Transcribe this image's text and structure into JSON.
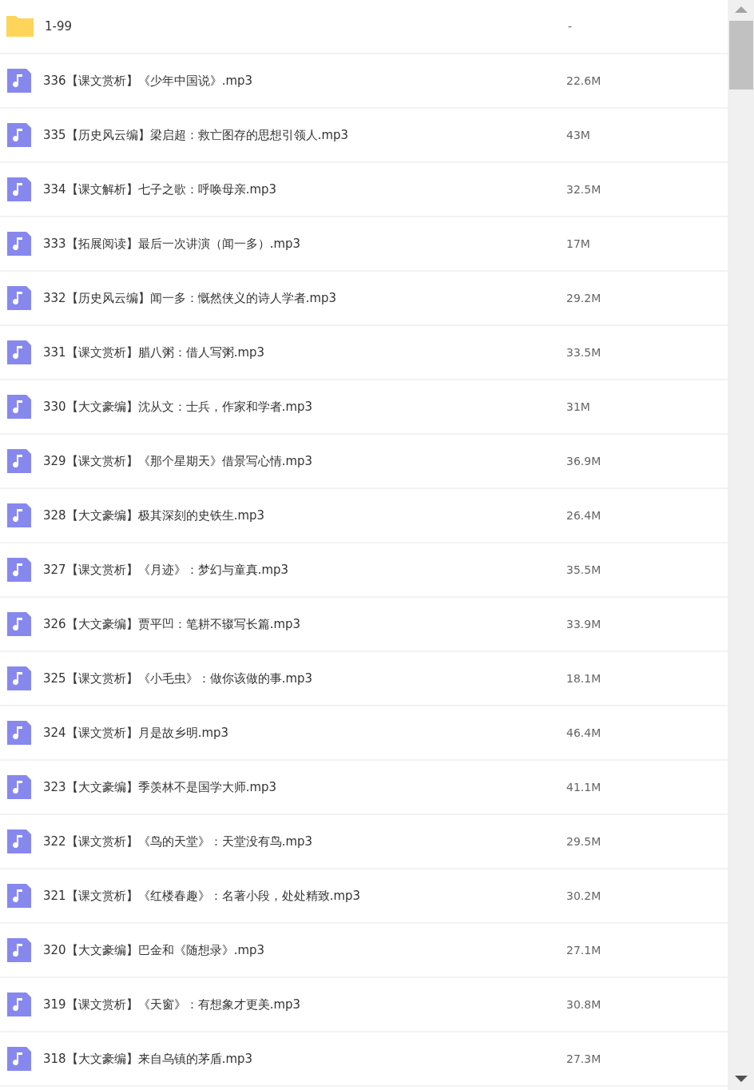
{
  "files": [
    {
      "kind": "folder",
      "name": "1-99",
      "size": "-"
    },
    {
      "kind": "audio",
      "name": "336【课文赏析】《少年中国说》.mp3",
      "size": "22.6M"
    },
    {
      "kind": "audio",
      "name": "335【历史风云编】梁启超：救亡图存的思想引领人.mp3",
      "size": "43M"
    },
    {
      "kind": "audio",
      "name": "334【课文解析】七子之歌：呼唤母亲.mp3",
      "size": "32.5M"
    },
    {
      "kind": "audio",
      "name": "333【拓展阅读】最后一次讲演（闻一多）.mp3",
      "size": "17M"
    },
    {
      "kind": "audio",
      "name": "332【历史风云编】闻一多：慨然侠义的诗人学者.mp3",
      "size": "29.2M"
    },
    {
      "kind": "audio",
      "name": "331【课文赏析】腊八粥：借人写粥.mp3",
      "size": "33.5M"
    },
    {
      "kind": "audio",
      "name": "330【大文豪编】沈从文：士兵，作家和学者.mp3",
      "size": "31M"
    },
    {
      "kind": "audio",
      "name": "329【课文赏析】《那个星期天》借景写心情.mp3",
      "size": "36.9M"
    },
    {
      "kind": "audio",
      "name": "328【大文豪编】极其深刻的史铁生.mp3",
      "size": "26.4M"
    },
    {
      "kind": "audio",
      "name": "327【课文赏析】《月迹》：梦幻与童真.mp3",
      "size": "35.5M"
    },
    {
      "kind": "audio",
      "name": "326【大文豪编】贾平凹：笔耕不辍写长篇.mp3",
      "size": "33.9M"
    },
    {
      "kind": "audio",
      "name": "325【课文赏析】《小毛虫》：做你该做的事.mp3",
      "size": "18.1M"
    },
    {
      "kind": "audio",
      "name": "324【课文赏析】月是故乡明.mp3",
      "size": "46.4M"
    },
    {
      "kind": "audio",
      "name": "323【大文豪编】季羡林不是国学大师.mp3",
      "size": "41.1M"
    },
    {
      "kind": "audio",
      "name": "322【课文赏析】《鸟的天堂》：天堂没有鸟.mp3",
      "size": "29.5M"
    },
    {
      "kind": "audio",
      "name": "321【课文赏析】《红楼春趣》：名著小段，处处精致.mp3",
      "size": "30.2M"
    },
    {
      "kind": "audio",
      "name": "320【大文豪编】巴金和《随想录》.mp3",
      "size": "27.1M"
    },
    {
      "kind": "audio",
      "name": "319【课文赏析】《天窗》：有想象才更美.mp3",
      "size": "30.8M"
    },
    {
      "kind": "audio",
      "name": "318【大文豪编】来自乌镇的茅盾.mp3",
      "size": "27.3M"
    }
  ]
}
